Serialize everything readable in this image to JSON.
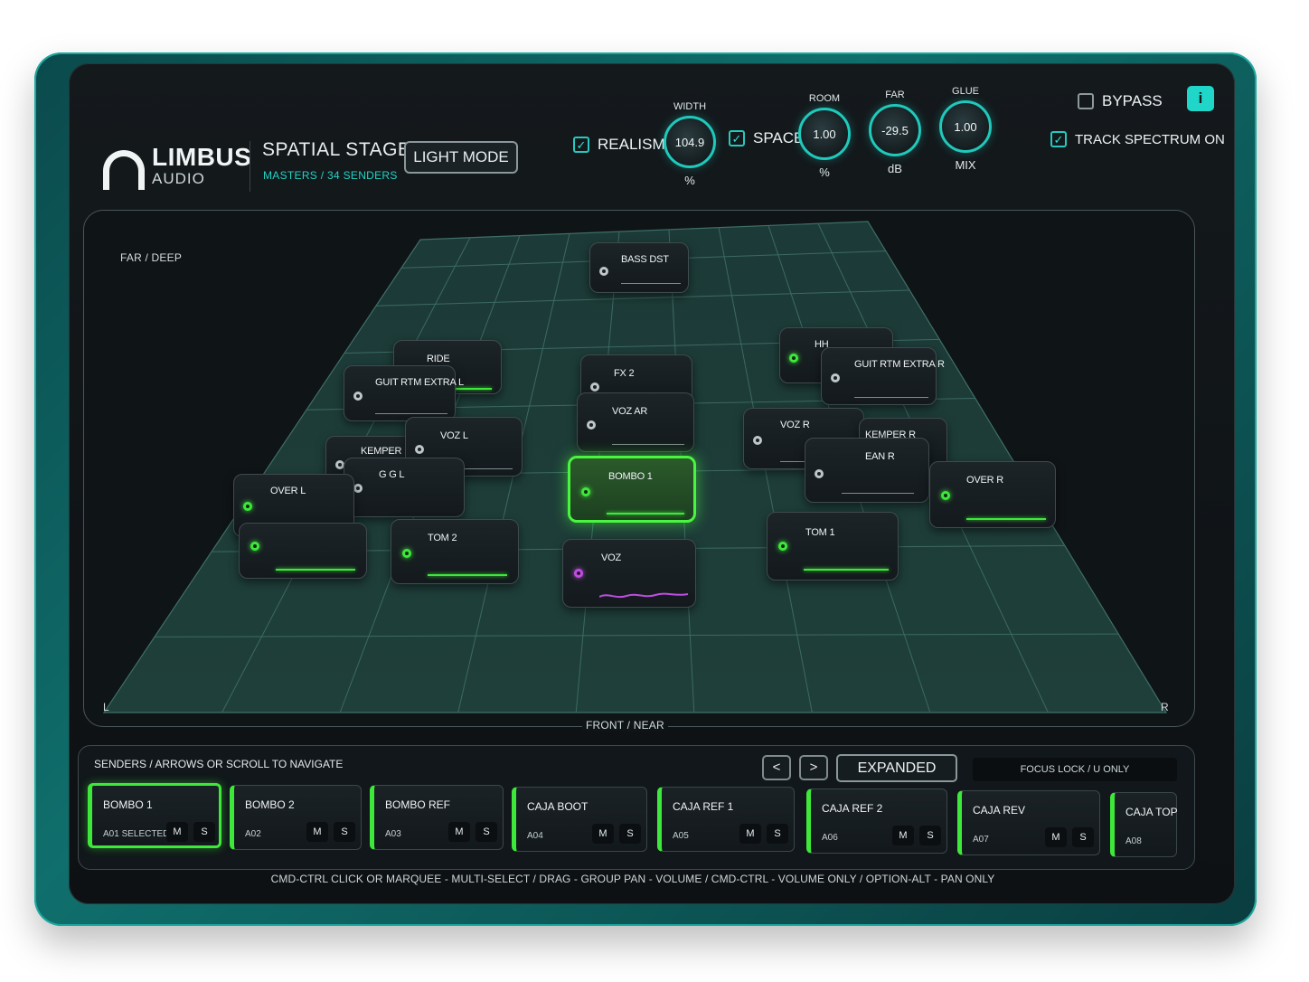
{
  "header": {
    "brand": "LIMBUS",
    "brand_sub": "AUDIO",
    "plugin_title": "SPATIAL STAGE",
    "plugin_sub": "MASTERS / 34 SENDERS",
    "light_mode": "LIGHT MODE",
    "realism": {
      "label": "REALISM",
      "checked": true
    },
    "space": {
      "label": "SPACE",
      "checked": true
    },
    "bypass": {
      "label": "BYPASS",
      "checked": false
    },
    "track_spectrum": {
      "label": "TRACK SPECTRUM ON",
      "checked": true
    },
    "info": "i",
    "knobs": [
      {
        "top": "WIDTH",
        "value": "104.9",
        "bottom": "%"
      },
      {
        "top": "ROOM",
        "value": "1.00",
        "bottom": "%"
      },
      {
        "top": "FAR",
        "value": "-29.5",
        "bottom": "dB"
      },
      {
        "top": "GLUE",
        "value": "1.00",
        "bottom": "MIX"
      }
    ]
  },
  "stage": {
    "far_label": "FAR / DEEP",
    "front_label": "FRONT / NEAR",
    "left_label": "L",
    "right_label": "R",
    "nodes": [
      {
        "name": "BASS DST",
        "dot": "grey"
      },
      {
        "name": "RIDE",
        "dot": "none"
      },
      {
        "name": "GUIT RTM EXTRA L",
        "dot": "grey"
      },
      {
        "name": "FX 2",
        "dot": "grey"
      },
      {
        "name": "VOZ AR",
        "dot": "grey"
      },
      {
        "name": "HH",
        "dot": "green"
      },
      {
        "name": "GUIT RTM EXTRA R",
        "dot": "grey"
      },
      {
        "name": "VOZ L",
        "dot": "grey"
      },
      {
        "name": "KEMPER L",
        "dot": "grey"
      },
      {
        "name": "G G L",
        "dot": "grey"
      },
      {
        "name": "VOZ R",
        "dot": "grey"
      },
      {
        "name": "KEMPER R",
        "dot": "none"
      },
      {
        "name": "EAN R",
        "dot": "grey"
      },
      {
        "name": "OVER L",
        "dot": "green"
      },
      {
        "name": "",
        "dot": "green"
      },
      {
        "name": "TOM 2",
        "dot": "green"
      },
      {
        "name": "BOMBO 1",
        "dot": "green"
      },
      {
        "name": "VOZ",
        "dot": "purple"
      },
      {
        "name": "TOM 1",
        "dot": "green"
      },
      {
        "name": "OVER R",
        "dot": "green"
      }
    ]
  },
  "senders": {
    "title": "SENDERS / ARROWS OR SCROLL TO NAVIGATE",
    "prev": "<",
    "next": ">",
    "expanded": "EXPANDED",
    "focus_lock": "FOCUS LOCK / U ONLY",
    "mute": "M",
    "solo": "S",
    "cards": [
      {
        "name": "BOMBO 1",
        "id": "A01 SELECTED",
        "selected": true
      },
      {
        "name": "BOMBO 2",
        "id": "A02",
        "selected": false
      },
      {
        "name": "BOMBO REF",
        "id": "A03",
        "selected": false
      },
      {
        "name": "CAJA BOOT",
        "id": "A04",
        "selected": false
      },
      {
        "name": "CAJA REF 1",
        "id": "A05",
        "selected": false
      },
      {
        "name": "CAJA REF 2",
        "id": "A06",
        "selected": false
      },
      {
        "name": "CAJA REV",
        "id": "A07",
        "selected": false
      },
      {
        "name": "CAJA TOP",
        "id": "A08",
        "selected": false
      }
    ]
  },
  "footer_help": "CMD-CTRL CLICK OR MARQUEE - MULTI-SELECT / DRAG - GROUP PAN - VOLUME / CMD-CTRL - VOLUME ONLY / OPTION-ALT - PAN ONLY",
  "colors": {
    "accent": "#1fd6c8",
    "active_green": "#3ee83a",
    "purple": "#c04de0"
  }
}
